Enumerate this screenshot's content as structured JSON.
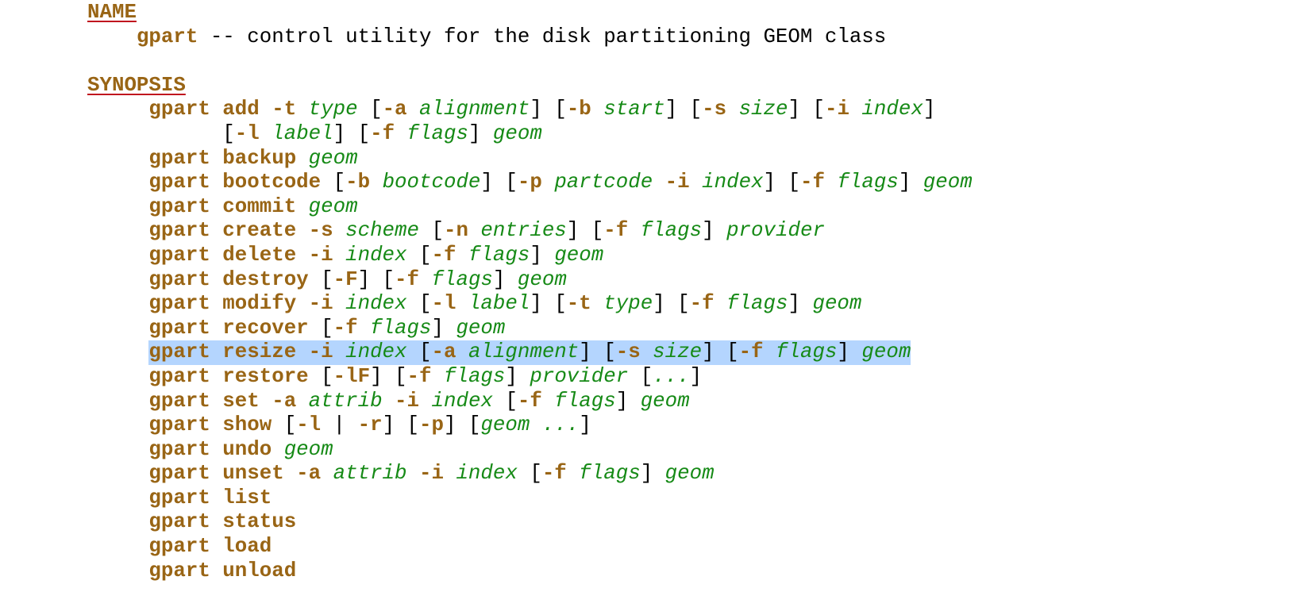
{
  "sections": {
    "name_heading": "NAME",
    "name_line": [
      [
        "b",
        "gpart"
      ],
      [
        "n",
        " -- control utility for the disk partitioning GEOM class"
      ]
    ],
    "synopsis_heading": "SYNOPSIS"
  },
  "selected_line_index": 10,
  "colors": {
    "command": "#996515",
    "argument": "#168a16",
    "selection": "#b4d5fe",
    "heading_underline": "#c0141e"
  },
  "synopsis": [
    [
      [
        "b",
        "gpart add -t"
      ],
      [
        "n",
        " "
      ],
      [
        "i",
        "type"
      ],
      [
        "n",
        " ["
      ],
      [
        "b",
        "-a"
      ],
      [
        "n",
        " "
      ],
      [
        "i",
        "alignment"
      ],
      [
        "n",
        "] ["
      ],
      [
        "b",
        "-b"
      ],
      [
        "n",
        " "
      ],
      [
        "i",
        "start"
      ],
      [
        "n",
        "] ["
      ],
      [
        "b",
        "-s"
      ],
      [
        "n",
        " "
      ],
      [
        "i",
        "size"
      ],
      [
        "n",
        "] ["
      ],
      [
        "b",
        "-i"
      ],
      [
        "n",
        " "
      ],
      [
        "i",
        "index"
      ],
      [
        "n",
        "]"
      ]
    ],
    [
      [
        "n",
        "      ["
      ],
      [
        "b",
        "-l"
      ],
      [
        "n",
        " "
      ],
      [
        "i",
        "label"
      ],
      [
        "n",
        "] ["
      ],
      [
        "b",
        "-f"
      ],
      [
        "n",
        " "
      ],
      [
        "i",
        "flags"
      ],
      [
        "n",
        "] "
      ],
      [
        "i",
        "geom"
      ]
    ],
    [
      [
        "b",
        "gpart backup"
      ],
      [
        "n",
        " "
      ],
      [
        "i",
        "geom"
      ]
    ],
    [
      [
        "b",
        "gpart bootcode"
      ],
      [
        "n",
        " ["
      ],
      [
        "b",
        "-b"
      ],
      [
        "n",
        " "
      ],
      [
        "i",
        "bootcode"
      ],
      [
        "n",
        "] ["
      ],
      [
        "b",
        "-p"
      ],
      [
        "n",
        " "
      ],
      [
        "i",
        "partcode"
      ],
      [
        "n",
        " "
      ],
      [
        "b",
        "-i"
      ],
      [
        "n",
        " "
      ],
      [
        "i",
        "index"
      ],
      [
        "n",
        "] ["
      ],
      [
        "b",
        "-f"
      ],
      [
        "n",
        " "
      ],
      [
        "i",
        "flags"
      ],
      [
        "n",
        "] "
      ],
      [
        "i",
        "geom"
      ]
    ],
    [
      [
        "b",
        "gpart commit"
      ],
      [
        "n",
        " "
      ],
      [
        "i",
        "geom"
      ]
    ],
    [
      [
        "b",
        "gpart create -s"
      ],
      [
        "n",
        " "
      ],
      [
        "i",
        "scheme"
      ],
      [
        "n",
        " ["
      ],
      [
        "b",
        "-n"
      ],
      [
        "n",
        " "
      ],
      [
        "i",
        "entries"
      ],
      [
        "n",
        "] ["
      ],
      [
        "b",
        "-f"
      ],
      [
        "n",
        " "
      ],
      [
        "i",
        "flags"
      ],
      [
        "n",
        "] "
      ],
      [
        "i",
        "provider"
      ]
    ],
    [
      [
        "b",
        "gpart delete -i"
      ],
      [
        "n",
        " "
      ],
      [
        "i",
        "index"
      ],
      [
        "n",
        " ["
      ],
      [
        "b",
        "-f"
      ],
      [
        "n",
        " "
      ],
      [
        "i",
        "flags"
      ],
      [
        "n",
        "] "
      ],
      [
        "i",
        "geom"
      ]
    ],
    [
      [
        "b",
        "gpart destroy"
      ],
      [
        "n",
        " ["
      ],
      [
        "b",
        "-F"
      ],
      [
        "n",
        "] ["
      ],
      [
        "b",
        "-f"
      ],
      [
        "n",
        " "
      ],
      [
        "i",
        "flags"
      ],
      [
        "n",
        "] "
      ],
      [
        "i",
        "geom"
      ]
    ],
    [
      [
        "b",
        "gpart modify -i"
      ],
      [
        "n",
        " "
      ],
      [
        "i",
        "index"
      ],
      [
        "n",
        " ["
      ],
      [
        "b",
        "-l"
      ],
      [
        "n",
        " "
      ],
      [
        "i",
        "label"
      ],
      [
        "n",
        "] ["
      ],
      [
        "b",
        "-t"
      ],
      [
        "n",
        " "
      ],
      [
        "i",
        "type"
      ],
      [
        "n",
        "] ["
      ],
      [
        "b",
        "-f"
      ],
      [
        "n",
        " "
      ],
      [
        "i",
        "flags"
      ],
      [
        "n",
        "] "
      ],
      [
        "i",
        "geom"
      ]
    ],
    [
      [
        "b",
        "gpart recover"
      ],
      [
        "n",
        " ["
      ],
      [
        "b",
        "-f"
      ],
      [
        "n",
        " "
      ],
      [
        "i",
        "flags"
      ],
      [
        "n",
        "] "
      ],
      [
        "i",
        "geom"
      ]
    ],
    [
      [
        "b",
        "gpart resize -i"
      ],
      [
        "n",
        " "
      ],
      [
        "i",
        "index"
      ],
      [
        "n",
        " ["
      ],
      [
        "b",
        "-a"
      ],
      [
        "n",
        " "
      ],
      [
        "i",
        "alignment"
      ],
      [
        "n",
        "] ["
      ],
      [
        "b",
        "-s"
      ],
      [
        "n",
        " "
      ],
      [
        "i",
        "size"
      ],
      [
        "n",
        "] ["
      ],
      [
        "b",
        "-f"
      ],
      [
        "n",
        " "
      ],
      [
        "i",
        "flags"
      ],
      [
        "n",
        "] "
      ],
      [
        "i",
        "geom"
      ]
    ],
    [
      [
        "b",
        "gpart restore"
      ],
      [
        "n",
        " ["
      ],
      [
        "b",
        "-lF"
      ],
      [
        "n",
        "] ["
      ],
      [
        "b",
        "-f"
      ],
      [
        "n",
        " "
      ],
      [
        "i",
        "flags"
      ],
      [
        "n",
        "] "
      ],
      [
        "i",
        "provider"
      ],
      [
        "n",
        " ["
      ],
      [
        "i",
        "..."
      ],
      [
        "n",
        "]"
      ]
    ],
    [
      [
        "b",
        "gpart set -a"
      ],
      [
        "n",
        " "
      ],
      [
        "i",
        "attrib"
      ],
      [
        "n",
        " "
      ],
      [
        "b",
        "-i"
      ],
      [
        "n",
        " "
      ],
      [
        "i",
        "index"
      ],
      [
        "n",
        " ["
      ],
      [
        "b",
        "-f"
      ],
      [
        "n",
        " "
      ],
      [
        "i",
        "flags"
      ],
      [
        "n",
        "] "
      ],
      [
        "i",
        "geom"
      ]
    ],
    [
      [
        "b",
        "gpart show"
      ],
      [
        "n",
        " ["
      ],
      [
        "b",
        "-l"
      ],
      [
        "n",
        " | "
      ],
      [
        "b",
        "-r"
      ],
      [
        "n",
        "] ["
      ],
      [
        "b",
        "-p"
      ],
      [
        "n",
        "] ["
      ],
      [
        "i",
        "geom ..."
      ],
      [
        "n",
        "]"
      ]
    ],
    [
      [
        "b",
        "gpart undo"
      ],
      [
        "n",
        " "
      ],
      [
        "i",
        "geom"
      ]
    ],
    [
      [
        "b",
        "gpart unset -a"
      ],
      [
        "n",
        " "
      ],
      [
        "i",
        "attrib"
      ],
      [
        "n",
        " "
      ],
      [
        "b",
        "-i"
      ],
      [
        "n",
        " "
      ],
      [
        "i",
        "index"
      ],
      [
        "n",
        " ["
      ],
      [
        "b",
        "-f"
      ],
      [
        "n",
        " "
      ],
      [
        "i",
        "flags"
      ],
      [
        "n",
        "] "
      ],
      [
        "i",
        "geom"
      ]
    ],
    [
      [
        "b",
        "gpart list"
      ]
    ],
    [
      [
        "b",
        "gpart status"
      ]
    ],
    [
      [
        "b",
        "gpart load"
      ]
    ],
    [
      [
        "b",
        "gpart unload"
      ]
    ]
  ]
}
